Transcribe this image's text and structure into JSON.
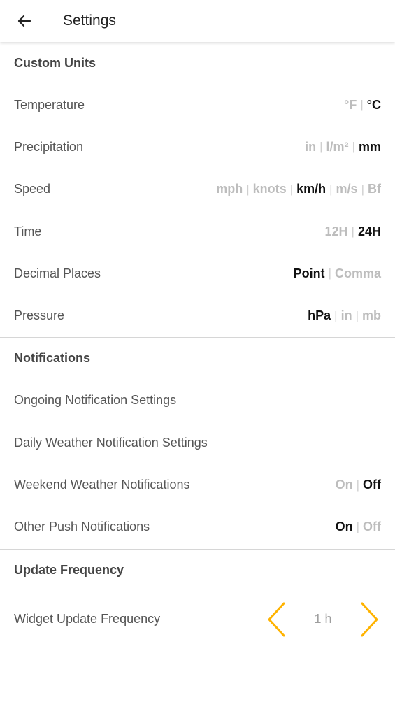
{
  "header": {
    "title": "Settings",
    "back_icon": "arrow-left"
  },
  "accent_color": "#FFB300",
  "sections": {
    "custom_units": {
      "title": "Custom Units",
      "rows": [
        {
          "label": "Temperature",
          "options": [
            "°F",
            "°C"
          ],
          "selected": 1
        },
        {
          "label": "Precipitation",
          "options": [
            "in",
            "l/m²",
            "mm"
          ],
          "selected": 2
        },
        {
          "label": "Speed",
          "options": [
            "mph",
            "knots",
            "km/h",
            "m/s",
            "Bf"
          ],
          "selected": 2
        },
        {
          "label": "Time",
          "options": [
            "12H",
            "24H"
          ],
          "selected": 1
        },
        {
          "label": "Decimal Places",
          "options": [
            "Point",
            "Comma"
          ],
          "selected": 0
        },
        {
          "label": "Pressure",
          "options": [
            "hPa",
            "in",
            "mb"
          ],
          "selected": 0
        }
      ]
    },
    "notifications": {
      "title": "Notifications",
      "links": [
        {
          "label": "Ongoing Notification Settings"
        },
        {
          "label": "Daily Weather Notification Settings"
        }
      ],
      "rows": [
        {
          "label": "Weekend Weather Notifications",
          "options": [
            "On",
            "Off"
          ],
          "selected": 1
        },
        {
          "label": "Other Push Notifications",
          "options": [
            "On",
            "Off"
          ],
          "selected": 0
        }
      ]
    },
    "update_frequency": {
      "title": "Update Frequency",
      "widget": {
        "label": "Widget Update Frequency",
        "value": "1 h",
        "prev_icon": "chevron-left",
        "next_icon": "chevron-right"
      }
    }
  },
  "separator": "|"
}
